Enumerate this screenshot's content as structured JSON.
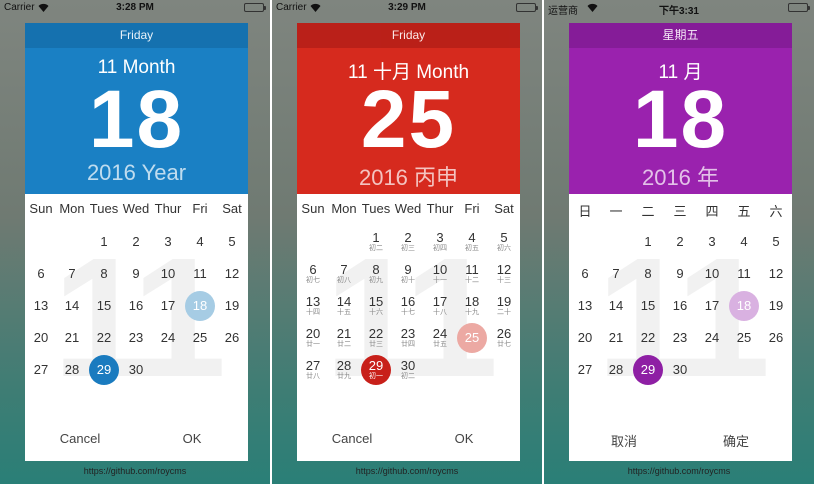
{
  "screens": [
    {
      "carrier": "Carrier",
      "time": "3:28 PM",
      "weekday": "Friday",
      "month_line": "11 Month",
      "day": "18",
      "year_line": "2016 Year",
      "watermark": "11",
      "weekdays": [
        "Sun",
        "Mon",
        "Tues",
        "Wed",
        "Thur",
        "Fri",
        "Sat"
      ],
      "days": [
        {
          "d": "1",
          "c": 2,
          "r": 0
        },
        {
          "d": "2",
          "c": 3,
          "r": 0
        },
        {
          "d": "3",
          "c": 4,
          "r": 0
        },
        {
          "d": "4",
          "c": 5,
          "r": 0
        },
        {
          "d": "5",
          "c": 6,
          "r": 0
        },
        {
          "d": "6",
          "c": 0,
          "r": 1
        },
        {
          "d": "7",
          "c": 1,
          "r": 1
        },
        {
          "d": "8",
          "c": 2,
          "r": 1
        },
        {
          "d": "9",
          "c": 3,
          "r": 1
        },
        {
          "d": "10",
          "c": 4,
          "r": 1
        },
        {
          "d": "11",
          "c": 5,
          "r": 1
        },
        {
          "d": "12",
          "c": 6,
          "r": 1
        },
        {
          "d": "13",
          "c": 0,
          "r": 2
        },
        {
          "d": "14",
          "c": 1,
          "r": 2
        },
        {
          "d": "15",
          "c": 2,
          "r": 2
        },
        {
          "d": "16",
          "c": 3,
          "r": 2
        },
        {
          "d": "17",
          "c": 4,
          "r": 2
        },
        {
          "d": "18",
          "c": 5,
          "r": 2,
          "state": "today"
        },
        {
          "d": "19",
          "c": 6,
          "r": 2
        },
        {
          "d": "20",
          "c": 0,
          "r": 3
        },
        {
          "d": "21",
          "c": 1,
          "r": 3
        },
        {
          "d": "22",
          "c": 2,
          "r": 3
        },
        {
          "d": "23",
          "c": 3,
          "r": 3
        },
        {
          "d": "24",
          "c": 4,
          "r": 3
        },
        {
          "d": "25",
          "c": 5,
          "r": 3
        },
        {
          "d": "26",
          "c": 6,
          "r": 3
        },
        {
          "d": "27",
          "c": 0,
          "r": 4
        },
        {
          "d": "28",
          "c": 1,
          "r": 4
        },
        {
          "d": "29",
          "c": 2,
          "r": 4,
          "state": "selected"
        },
        {
          "d": "30",
          "c": 3,
          "r": 4
        }
      ],
      "cancel_label": "Cancel",
      "ok_label": "OK",
      "url": "https://github.com/roycms",
      "color_header": "#1a80c4",
      "color_weekday_bar": "#1570ad",
      "color_selected": "#1a7bbf",
      "color_today": "#a6cce4"
    },
    {
      "carrier": "Carrier",
      "time": "3:29 PM",
      "weekday": "Friday",
      "month_line": "11 十月 Month",
      "day": "25",
      "year_line": "2016 丙申",
      "watermark": "11",
      "weekdays": [
        "Sun",
        "Mon",
        "Tues",
        "Wed",
        "Thur",
        "Fri",
        "Sat"
      ],
      "days": [
        {
          "d": "1",
          "l": "初二",
          "c": 2,
          "r": 0
        },
        {
          "d": "2",
          "l": "初三",
          "c": 3,
          "r": 0
        },
        {
          "d": "3",
          "l": "初四",
          "c": 4,
          "r": 0
        },
        {
          "d": "4",
          "l": "初五",
          "c": 5,
          "r": 0
        },
        {
          "d": "5",
          "l": "初六",
          "c": 6,
          "r": 0
        },
        {
          "d": "6",
          "l": "初七",
          "c": 0,
          "r": 1
        },
        {
          "d": "7",
          "l": "初八",
          "c": 1,
          "r": 1
        },
        {
          "d": "8",
          "l": "初九",
          "c": 2,
          "r": 1
        },
        {
          "d": "9",
          "l": "初十",
          "c": 3,
          "r": 1
        },
        {
          "d": "10",
          "l": "十一",
          "c": 4,
          "r": 1
        },
        {
          "d": "11",
          "l": "十二",
          "c": 5,
          "r": 1
        },
        {
          "d": "12",
          "l": "十三",
          "c": 6,
          "r": 1
        },
        {
          "d": "13",
          "l": "十四",
          "c": 0,
          "r": 2
        },
        {
          "d": "14",
          "l": "十五",
          "c": 1,
          "r": 2
        },
        {
          "d": "15",
          "l": "十六",
          "c": 2,
          "r": 2
        },
        {
          "d": "16",
          "l": "十七",
          "c": 3,
          "r": 2
        },
        {
          "d": "17",
          "l": "十八",
          "c": 4,
          "r": 2
        },
        {
          "d": "18",
          "l": "十九",
          "c": 5,
          "r": 2
        },
        {
          "d": "19",
          "l": "二十",
          "c": 6,
          "r": 2
        },
        {
          "d": "20",
          "l": "廿一",
          "c": 0,
          "r": 3
        },
        {
          "d": "21",
          "l": "廿二",
          "c": 1,
          "r": 3
        },
        {
          "d": "22",
          "l": "廿三",
          "c": 2,
          "r": 3
        },
        {
          "d": "23",
          "l": "廿四",
          "c": 3,
          "r": 3
        },
        {
          "d": "24",
          "l": "廿五",
          "c": 4,
          "r": 3
        },
        {
          "d": "25",
          "c": 5,
          "r": 3,
          "state": "today"
        },
        {
          "d": "26",
          "l": "廿七",
          "c": 6,
          "r": 3
        },
        {
          "d": "27",
          "l": "廿八",
          "c": 0,
          "r": 4
        },
        {
          "d": "28",
          "l": "廿九",
          "c": 1,
          "r": 4
        },
        {
          "d": "29",
          "l": "初一",
          "c": 2,
          "r": 4,
          "state": "selected"
        },
        {
          "d": "30",
          "l": "初二",
          "c": 3,
          "r": 4
        }
      ],
      "cancel_label": "Cancel",
      "ok_label": "OK",
      "url": "https://github.com/roycms",
      "color_header": "#d62a1e",
      "color_weekday_bar": "#b71f18",
      "color_selected": "#c8201a",
      "color_today": "#eca9a3"
    },
    {
      "carrier": "运营商",
      "time": "下午3:31",
      "weekday": "星期五",
      "month_line": "11 月",
      "day": "18",
      "year_line": "2016 年",
      "watermark": "11",
      "weekdays": [
        "日",
        "一",
        "二",
        "三",
        "四",
        "五",
        "六"
      ],
      "days": [
        {
          "d": "1",
          "c": 2,
          "r": 0
        },
        {
          "d": "2",
          "c": 3,
          "r": 0
        },
        {
          "d": "3",
          "c": 4,
          "r": 0
        },
        {
          "d": "4",
          "c": 5,
          "r": 0
        },
        {
          "d": "5",
          "c": 6,
          "r": 0
        },
        {
          "d": "6",
          "c": 0,
          "r": 1
        },
        {
          "d": "7",
          "c": 1,
          "r": 1
        },
        {
          "d": "8",
          "c": 2,
          "r": 1
        },
        {
          "d": "9",
          "c": 3,
          "r": 1
        },
        {
          "d": "10",
          "c": 4,
          "r": 1
        },
        {
          "d": "11",
          "c": 5,
          "r": 1
        },
        {
          "d": "12",
          "c": 6,
          "r": 1
        },
        {
          "d": "13",
          "c": 0,
          "r": 2
        },
        {
          "d": "14",
          "c": 1,
          "r": 2
        },
        {
          "d": "15",
          "c": 2,
          "r": 2
        },
        {
          "d": "16",
          "c": 3,
          "r": 2
        },
        {
          "d": "17",
          "c": 4,
          "r": 2
        },
        {
          "d": "18",
          "c": 5,
          "r": 2,
          "state": "today"
        },
        {
          "d": "19",
          "c": 6,
          "r": 2
        },
        {
          "d": "20",
          "c": 0,
          "r": 3
        },
        {
          "d": "21",
          "c": 1,
          "r": 3
        },
        {
          "d": "22",
          "c": 2,
          "r": 3
        },
        {
          "d": "23",
          "c": 3,
          "r": 3
        },
        {
          "d": "24",
          "c": 4,
          "r": 3
        },
        {
          "d": "25",
          "c": 5,
          "r": 3
        },
        {
          "d": "26",
          "c": 6,
          "r": 3
        },
        {
          "d": "27",
          "c": 0,
          "r": 4
        },
        {
          "d": "28",
          "c": 1,
          "r": 4
        },
        {
          "d": "29",
          "c": 2,
          "r": 4,
          "state": "selected"
        },
        {
          "d": "30",
          "c": 3,
          "r": 4
        }
      ],
      "cancel_label": "取消",
      "ok_label": "确定",
      "url": "https://github.com/roycms",
      "color_header": "#9a22ae",
      "color_weekday_bar": "#831c96",
      "color_selected": "#8e1fa4",
      "color_today": "#d9b1e1"
    }
  ]
}
